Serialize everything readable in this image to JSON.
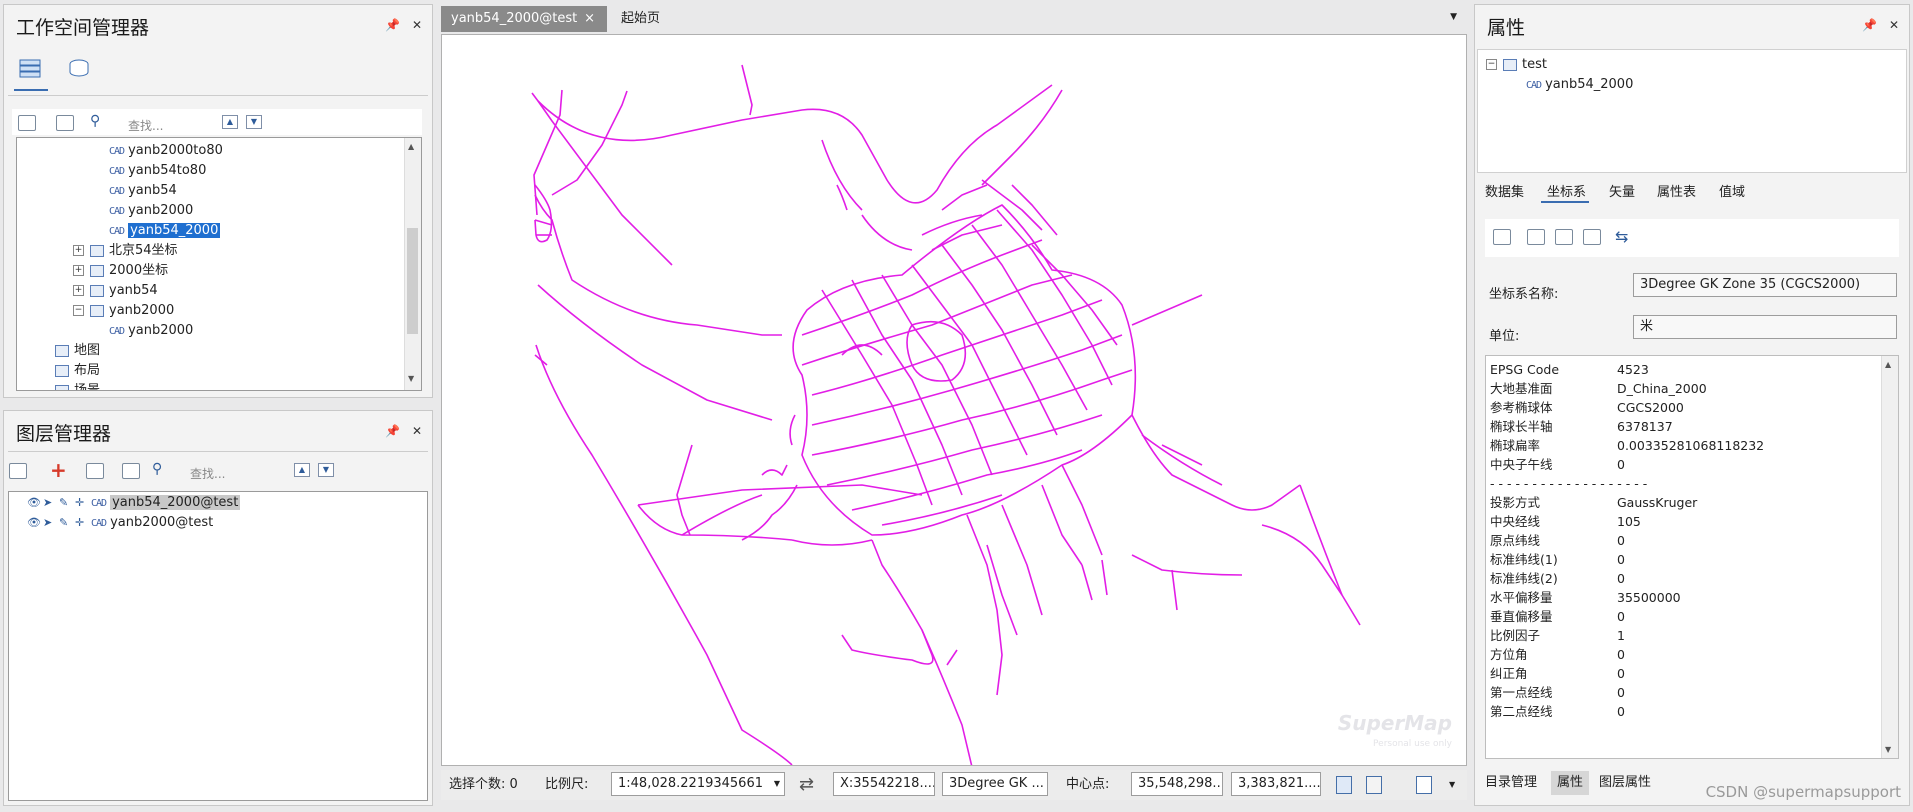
{
  "workspace": {
    "title": "工作空间管理器",
    "search_placeholder": "查找...",
    "tree": [
      {
        "label": "yanb2000to80",
        "kind": "cad",
        "indent": 3,
        "selected": false
      },
      {
        "label": "yanb54to80",
        "kind": "cad",
        "indent": 3,
        "selected": false
      },
      {
        "label": "yanb54",
        "kind": "cad",
        "indent": 3,
        "selected": false
      },
      {
        "label": "yanb2000",
        "kind": "cad",
        "indent": 3,
        "selected": false
      },
      {
        "label": "yanb54_2000",
        "kind": "cad",
        "indent": 3,
        "selected": true
      },
      {
        "label": "北京54坐标",
        "kind": "ds",
        "indent": 2,
        "expander": "+"
      },
      {
        "label": "2000坐标",
        "kind": "ds",
        "indent": 2,
        "expander": "+"
      },
      {
        "label": "yanb54",
        "kind": "ds",
        "indent": 2,
        "expander": "+"
      },
      {
        "label": "yanb2000",
        "kind": "ds",
        "indent": 2,
        "expander": "-"
      },
      {
        "label": "yanb2000",
        "kind": "cad",
        "indent": 3,
        "selected": false
      },
      {
        "label": "地图",
        "kind": "map",
        "indent": 1
      },
      {
        "label": "布局",
        "kind": "layout",
        "indent": 1
      },
      {
        "label": "场景",
        "kind": "scene",
        "indent": 1
      }
    ]
  },
  "layers": {
    "title": "图层管理器",
    "search_placeholder": "查找...",
    "items": [
      {
        "label": "yanb54_2000@test",
        "selected": true
      },
      {
        "label": "yanb2000@test",
        "selected": false
      }
    ]
  },
  "document": {
    "tabs": [
      {
        "label": "yanb54_2000@test",
        "active": true,
        "close": "×"
      },
      {
        "label": "起始页",
        "active": false
      }
    ],
    "watermark": "SuperMap",
    "watermark_sub": "Personal use only"
  },
  "statusbar": {
    "selected_label": "选择个数: 0",
    "scale_label": "比例尺:",
    "scale_value": "1:48,028.2219345661",
    "x_value": "X:35542218....",
    "crs_value": "3Degree GK ...",
    "center_label": "中心点:",
    "center_x": "35,548,298....",
    "center_y": "3,383,821...."
  },
  "properties": {
    "title": "属性",
    "tree_root": "test",
    "tree_child": "yanb54_2000",
    "tabs": [
      "数据集",
      "坐标系",
      "矢量",
      "属性表",
      "值域"
    ],
    "active_tab": "坐标系",
    "crs_name_label": "坐标系名称:",
    "crs_name_value": "3Degree GK Zone 35     (CGCS2000)",
    "unit_label": "单位:",
    "unit_value": "米",
    "rows": [
      {
        "k": "EPSG Code",
        "v": "4523"
      },
      {
        "k": "大地基准面",
        "v": "D_China_2000"
      },
      {
        "k": "参考椭球体",
        "v": "CGCS2000"
      },
      {
        "k": "椭球长半轴",
        "v": "6378137"
      },
      {
        "k": "椭球扁率",
        "v": "0.00335281068118232"
      },
      {
        "k": "中央子午线",
        "v": "0"
      },
      {
        "k": "- - - - - - - - - - - - - - - - - - -",
        "v": ""
      },
      {
        "k": "投影方式",
        "v": "GaussKruger"
      },
      {
        "k": "中央经线",
        "v": "105"
      },
      {
        "k": "原点纬线",
        "v": "0"
      },
      {
        "k": "标准纬线(1)",
        "v": "0"
      },
      {
        "k": "标准纬线(2)",
        "v": "0"
      },
      {
        "k": "水平偏移量",
        "v": "35500000"
      },
      {
        "k": "垂直偏移量",
        "v": "0"
      },
      {
        "k": "比例因子",
        "v": "1"
      },
      {
        "k": "方位角",
        "v": "0"
      },
      {
        "k": "纠正角",
        "v": "0"
      },
      {
        "k": "第一点经线",
        "v": "0"
      },
      {
        "k": "第二点经线",
        "v": "0"
      }
    ],
    "bottom_tabs": [
      "目录管理",
      "属性",
      "图层属性"
    ],
    "bottom_active": "属性"
  },
  "footer_credit": "CSDN @supermapsupport",
  "colors": {
    "road": "#e21ee6",
    "selection": "#1f6fd0"
  },
  "icons": [
    "pin-icon",
    "close-icon",
    "datasource-icon",
    "scene-icon",
    "search-icon",
    "up-arrow-icon",
    "down-arrow-icon",
    "eye-icon",
    "cad-icon"
  ]
}
